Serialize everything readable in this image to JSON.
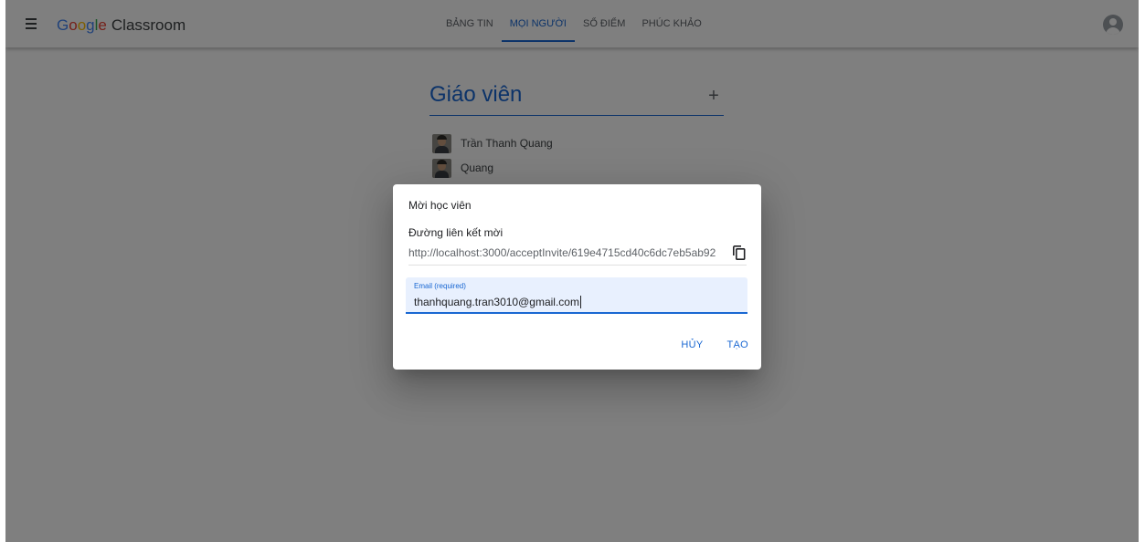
{
  "app": {
    "brand_letters": [
      "G",
      "o",
      "o",
      "g",
      "l",
      "e"
    ],
    "brand_rest": "Classroom"
  },
  "tabs": [
    {
      "label": "BẢNG TIN",
      "active": false
    },
    {
      "label": "MỌI NGƯỜI",
      "active": true
    },
    {
      "label": "SỔ ĐIỂM",
      "active": false
    },
    {
      "label": "PHÚC KHẢO",
      "active": false
    }
  ],
  "icons": {
    "menu": "menu-icon",
    "account": "account-circle-icon",
    "add": "plus-icon",
    "copy": "copy-icon"
  },
  "people": {
    "section_title": "Giáo viên",
    "add_symbol": "+",
    "teachers": [
      {
        "name": "Trần Thanh Quang"
      },
      {
        "name": "Quang"
      }
    ]
  },
  "dialog": {
    "title": "Mời học viên",
    "link_label": "Đường liên kết mời",
    "link_value": "http://localhost:3000/acceptInvite/619e4715cd40c6dc7eb5ab92",
    "email_label": "Email (required)",
    "email_value": "thanhquang.tran3010@gmail.com",
    "cancel_label": "HỦY",
    "create_label": "TẠO"
  },
  "colors": {
    "accent": "#1967d2",
    "overlay": "rgba(0,0,0,0.5)",
    "field_bg": "#e8f0fe"
  }
}
